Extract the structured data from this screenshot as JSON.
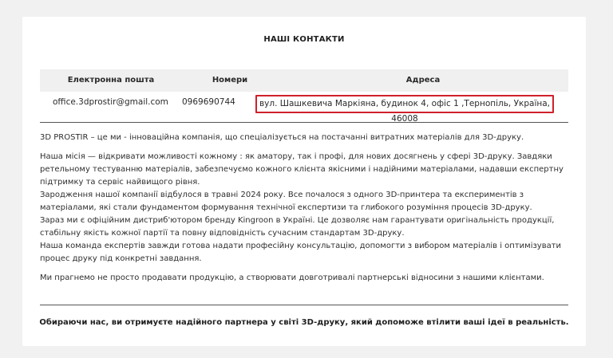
{
  "section_title": "НАШІ КОНТАКТИ",
  "contacts_table": {
    "headers": {
      "email": "Електронна пошта",
      "phone": "Номери",
      "address": "Адреса"
    },
    "row": {
      "email": "office.3dprostir@gmail.com",
      "phone": "0969690744",
      "address": "вул. Шашкевича Маркіяна, будинок 4, офіс 1 ,Тернопіль, Україна, 46008"
    }
  },
  "about": {
    "intro": "3D PROSTIR – це ми - інноваційна компанія, що спеціалізується на постачанні витратних матеріалів для 3D-друку.",
    "mission": "Наша місія — відкривати можливості кожному : як аматору, так і профі, для нових досягнень у сфері 3D-друку. Завдяки ретельному тестуванню матеріалів, забезпечуємо кожного клієнта якісними і надійними матеріалами,  надавши експертну підтримку та сервіс найвищого рівня.",
    "origin": " Зародження нашої компанії відбулося в травні 2024 року. Все почалося з одного 3D-принтера та експериментів з матеріалами, які стали фундаментом формування технічної експертизи та глибокого розуміння процесів 3D-друку.",
    "distributor": "Зараз ми є офіційним дистриб'ютором бренду Kingroon в Україні. Це дозволяє нам гарантувати оригінальність продукції, стабільну якість кожної партії та повну відповідність сучасним стандартам 3D-друку.",
    "team": "Наша команда експертів завжди готова надати професійну консультацію, допомогти з вибором матеріалів і оптимізувати процес друку під конкретні завдання.",
    "goal": "Ми прагнемо не просто продавати продукцію, а створювати довготривалі партнерські відносини з нашими клієнтами."
  },
  "closing": "Обираючи нас, ви отримуєте надійного партнера у світі 3D-друку, який допоможе втілити ваші ідеї в реальність.",
  "colors": {
    "highlight_border": "#d0202a",
    "page_bg": "#f1f1f1",
    "card_bg": "#ffffff",
    "table_head_bg": "#f0f0f0"
  }
}
